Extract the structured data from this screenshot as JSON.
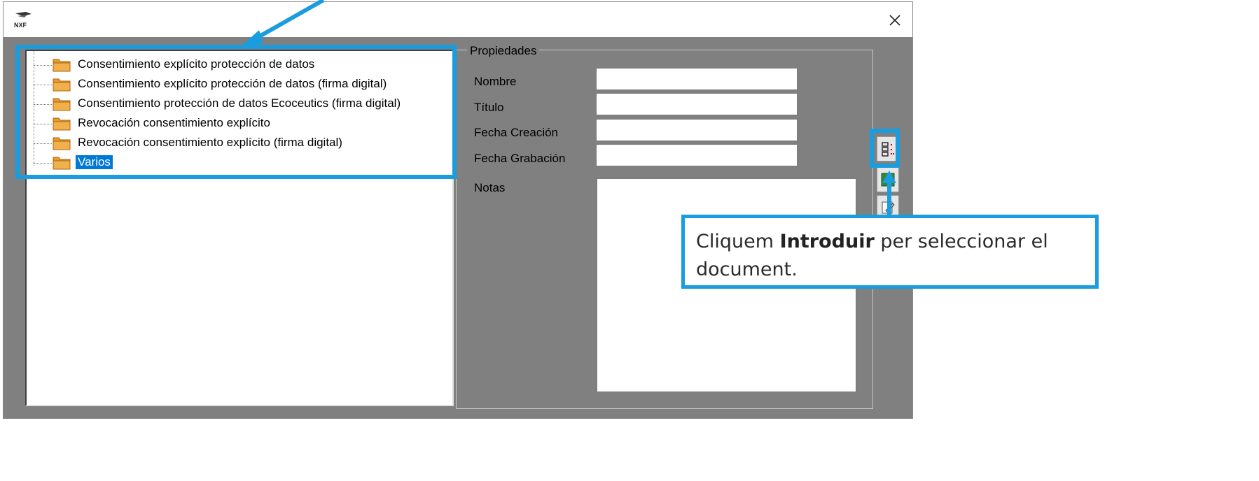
{
  "window": {
    "logo_text": "NXF",
    "close_glyph": "✕"
  },
  "tree": {
    "items": [
      {
        "label": "Consentimiento explícito protección de datos",
        "selected": false
      },
      {
        "label": "Consentimiento explícito protección de datos (firma digital)",
        "selected": false
      },
      {
        "label": "Consentimiento protección de datos Ecoceutics (firma digital)",
        "selected": false
      },
      {
        "label": "Revocación consentimiento explícito",
        "selected": false
      },
      {
        "label": "Revocación consentimiento explícito (firma digital)",
        "selected": false
      },
      {
        "label": "Varios",
        "selected": true
      }
    ],
    "icon": "folder-icon"
  },
  "properties": {
    "legend": "Propiedades",
    "nombre_label": "Nombre",
    "nombre_value": "",
    "titulo_label": "Título",
    "titulo_value": "",
    "fecha_creacion_label": "Fecha Creación",
    "fecha_creacion_value": "",
    "fecha_grabacion_label": "Fecha Grabación",
    "fecha_grabacion_value": "",
    "notas_label": "Notas",
    "notas_value": ""
  },
  "toolbar": {
    "buttons": [
      "introduce-document-icon",
      "image-icon",
      "edit-document-icon"
    ]
  },
  "callout": {
    "before": "Cliquem ",
    "bold": "Introduir",
    "after": " per seleccionar el document."
  },
  "colors": {
    "highlight": "#1a9ddf",
    "selection": "#0078d7",
    "folder": "#f2b04c",
    "client_bg": "#808080"
  }
}
